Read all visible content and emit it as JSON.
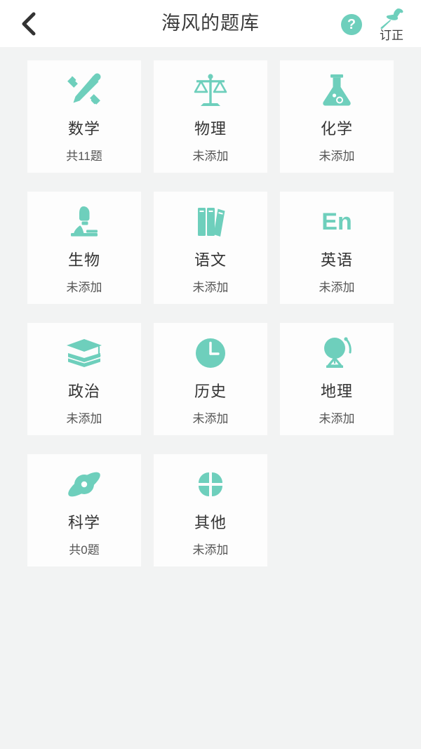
{
  "header": {
    "back_icon": "chevron-left-icon",
    "title": "海风的题库",
    "help_icon_label": "?",
    "pin_icon": "pushpin-icon",
    "pin_label": "订正"
  },
  "colors": {
    "accent": "#6ecfbc",
    "page_background": "#f2f3f3",
    "card_background": "#fdfdfd",
    "title_text": "#3b3b3b",
    "status_text": "#555555"
  },
  "subjects": [
    {
      "name": "数学",
      "status": "共11题",
      "icon": "pencil-ruler-icon"
    },
    {
      "name": "物理",
      "status": "未添加",
      "icon": "balance-scale-icon"
    },
    {
      "name": "化学",
      "status": "未添加",
      "icon": "flask-icon"
    },
    {
      "name": "生物",
      "status": "未添加",
      "icon": "microscope-icon"
    },
    {
      "name": "语文",
      "status": "未添加",
      "icon": "books-icon"
    },
    {
      "name": "英语",
      "status": "未添加",
      "icon": "en-text-icon",
      "icon_text": "En"
    },
    {
      "name": "政治",
      "status": "未添加",
      "icon": "graduation-cap-book-icon"
    },
    {
      "name": "历史",
      "status": "未添加",
      "icon": "clock-icon"
    },
    {
      "name": "地理",
      "status": "未添加",
      "icon": "globe-stand-icon"
    },
    {
      "name": "科学",
      "status": "共0题",
      "icon": "atom-orbit-icon"
    },
    {
      "name": "其他",
      "status": "未添加",
      "icon": "four-petal-icon"
    }
  ]
}
